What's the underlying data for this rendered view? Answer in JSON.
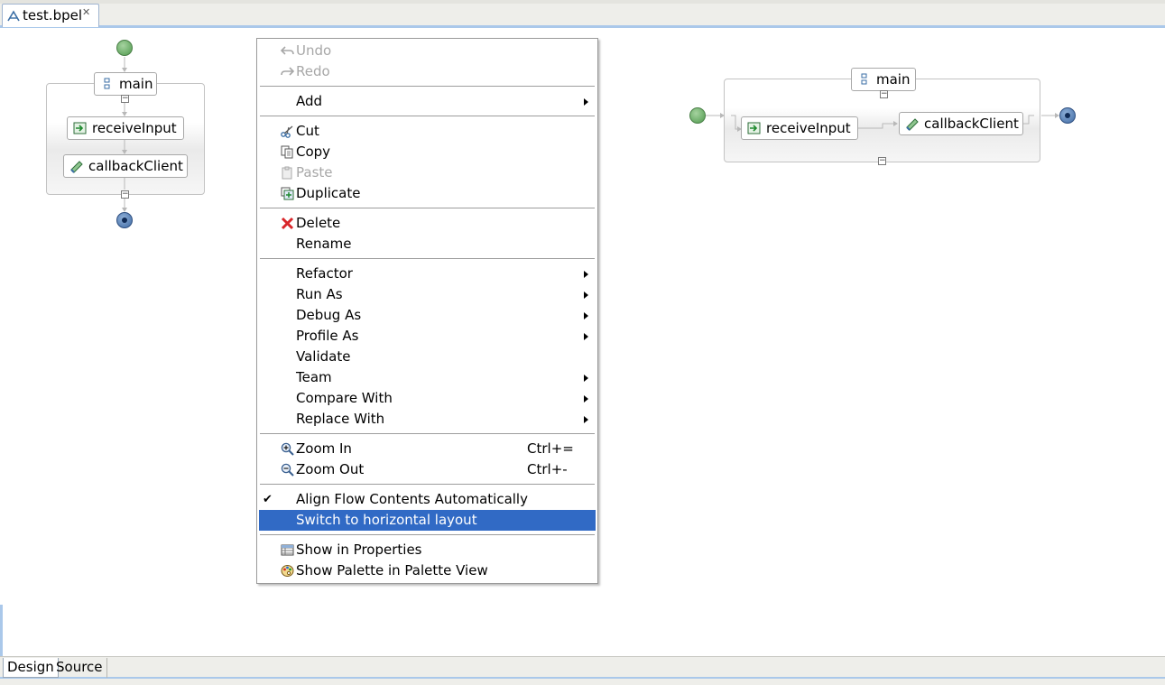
{
  "editor": {
    "tab_title": "test.bpel",
    "bottom_tabs": {
      "design": "Design",
      "source": "Source"
    }
  },
  "diagram_vertical": {
    "scope_label": "main",
    "activities": [
      "receiveInput",
      "callbackClient"
    ]
  },
  "diagram_horizontal": {
    "scope_label": "main",
    "activities": [
      "receiveInput",
      "callbackClient"
    ]
  },
  "context_menu": {
    "undo": "Undo",
    "redo": "Redo",
    "add": "Add",
    "cut": "Cut",
    "copy": "Copy",
    "paste": "Paste",
    "duplicate": "Duplicate",
    "delete": "Delete",
    "rename": "Rename",
    "refactor": "Refactor",
    "run_as": "Run As",
    "debug_as": "Debug As",
    "profile_as": "Profile As",
    "validate": "Validate",
    "team": "Team",
    "compare_with": "Compare With",
    "replace_with": "Replace With",
    "zoom_in": "Zoom In",
    "zoom_in_shortcut": "Ctrl+=",
    "zoom_out": "Zoom Out",
    "zoom_out_shortcut": "Ctrl+-",
    "align_flow": "Align Flow Contents Automatically",
    "switch_layout": "Switch to horizontal layout",
    "show_properties": "Show in Properties",
    "show_palette": "Show Palette in Palette View"
  },
  "colors": {
    "selection": "#316ac5",
    "start_node": "#4f9a4d",
    "end_node": "#3f6aa4"
  }
}
